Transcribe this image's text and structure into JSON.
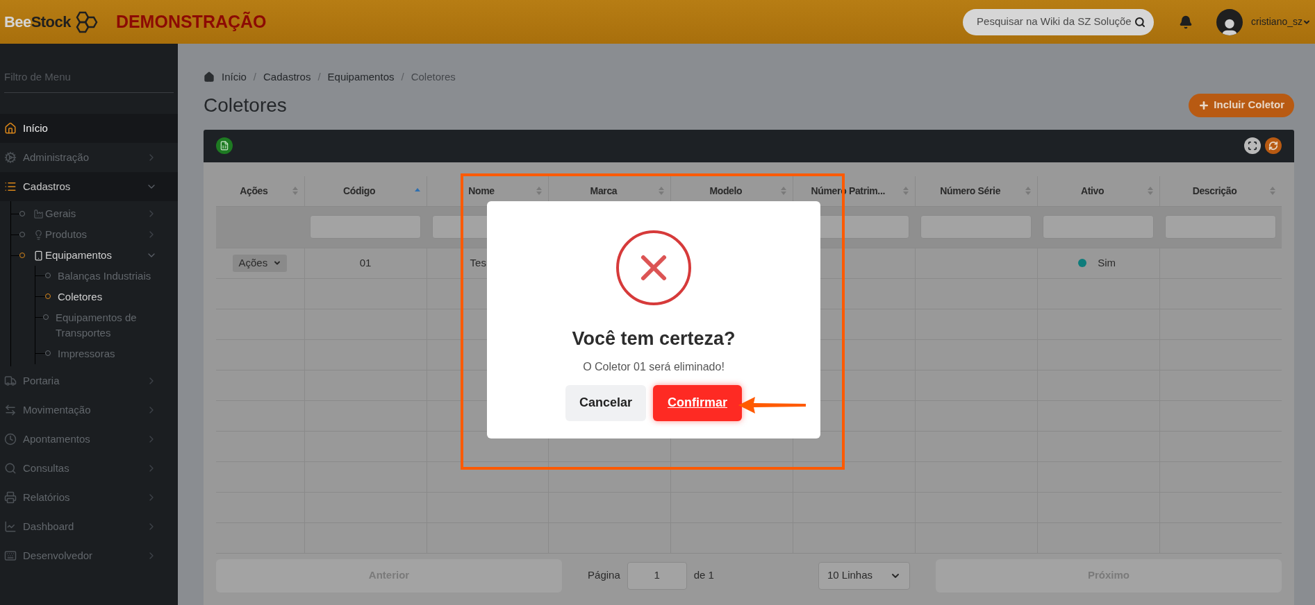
{
  "header": {
    "logo": [
      "Bee",
      "Stock"
    ],
    "environment": "DEMONSTRAÇÃO",
    "search": {
      "placeholder": "Pesquisar na Wiki da SZ Soluçõe"
    },
    "user": "cristiano_sz"
  },
  "sidebar": {
    "filter": {
      "placeholder": "Filtro de Menu"
    },
    "items": [
      {
        "label": "Início",
        "selected": true
      },
      {
        "label": "Administração",
        "selected": false,
        "expanded": false
      },
      {
        "label": "Cadastros",
        "selected": false,
        "expanded": true,
        "children": [
          {
            "label": "Gerais",
            "selected": false,
            "expanded": false
          },
          {
            "label": "Produtos",
            "selected": false,
            "expanded": false
          },
          {
            "label": "Equipamentos",
            "selected": true,
            "expanded": true,
            "children": [
              {
                "label": "Balanças Industriais",
                "selected": false
              },
              {
                "label": "Coletores",
                "selected": true
              },
              {
                "label": "Equipamentos de Transportes",
                "selected": false
              },
              {
                "label": "Impressoras",
                "selected": false
              }
            ]
          }
        ]
      },
      {
        "label": "Portaria",
        "selected": false,
        "expanded": false
      },
      {
        "label": "Movimentação",
        "selected": false,
        "expanded": false
      },
      {
        "label": "Apontamentos",
        "selected": false,
        "expanded": false
      },
      {
        "label": "Consultas",
        "selected": false,
        "expanded": false
      },
      {
        "label": "Relatórios",
        "selected": false,
        "expanded": false
      },
      {
        "label": "Dashboard",
        "selected": false,
        "expanded": false
      },
      {
        "label": "Desenvolvedor",
        "selected": false,
        "expanded": false
      }
    ]
  },
  "breadcrumb": {
    "separator": "/",
    "items": [
      "Início",
      "Cadastros",
      "Equipamentos",
      "Coletores"
    ]
  },
  "title": "Coletores",
  "add_button": "Incluir Coletor",
  "table": {
    "columns": [
      {
        "label": "Ações",
        "sorted_ascending": false
      },
      {
        "label": "Código",
        "sorted_ascending": true
      },
      {
        "label": "Nome",
        "sorted_ascending": false
      },
      {
        "label": "Marca",
        "sorted_ascending": false
      },
      {
        "label": "Modelo",
        "sorted_ascending": false
      },
      {
        "label": "Número Patrim...",
        "sorted_ascending": false
      },
      {
        "label": "Número Série",
        "sorted_ascending": false
      },
      {
        "label": "Ativo",
        "sorted_ascending": false
      },
      {
        "label": "Descrição",
        "sorted_ascending": false
      }
    ],
    "rows": [
      {
        "cells": [
          {
            "kind": "actions",
            "text": "Ações"
          },
          {
            "kind": "text",
            "text": "01"
          },
          {
            "kind": "text",
            "text": "Tes"
          },
          {
            "kind": "empty"
          },
          {
            "kind": "empty"
          },
          {
            "kind": "empty"
          },
          {
            "kind": "empty"
          },
          {
            "kind": "status",
            "text": "Sim",
            "color": "#0e7c7b"
          },
          {
            "kind": "empty"
          }
        ]
      }
    ]
  },
  "pagination": {
    "previous": {
      "label": "Anterior",
      "disabled": true
    },
    "page_label": "Página",
    "page": "1",
    "of": "de 1",
    "rows_per_page": "10 Linhas",
    "next": {
      "label": "Próximo",
      "disabled": true
    }
  },
  "dialog": {
    "title": "Você tem certeza?",
    "message": "O Coletor 01 será eliminado!",
    "cancel": "Cancelar",
    "confirm": "Confirmar"
  }
}
